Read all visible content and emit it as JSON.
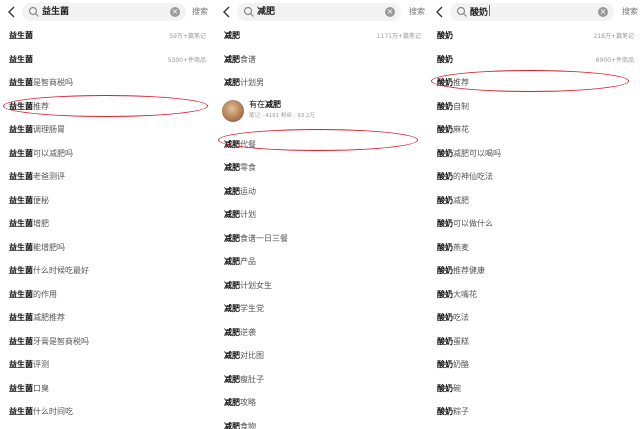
{
  "colors": {
    "highlight_oval": "#d21e2d",
    "search_bg": "#f3f3f3"
  },
  "panels": [
    {
      "query": "益生菌",
      "search_button": "搜索",
      "rows": [
        {
          "bold": "益生菌",
          "rest": "",
          "meta": "59万+篇笔记"
        },
        {
          "bold": "益生菌",
          "rest": "",
          "meta": "5300+件商品"
        },
        {
          "bold": "益生菌",
          "rest": "是智商税吗",
          "meta": ""
        },
        {
          "bold": "益生菌",
          "rest": "推荐",
          "meta": ""
        },
        {
          "bold": "益生菌",
          "rest": "调理肠胃",
          "meta": ""
        },
        {
          "bold": "益生菌",
          "rest": "可以减肥吗",
          "meta": ""
        },
        {
          "bold": "益生菌",
          "rest": "老爸测评",
          "meta": ""
        },
        {
          "bold": "益生菌",
          "rest": "便秘",
          "meta": ""
        },
        {
          "bold": "益生菌",
          "rest": "增肥",
          "meta": ""
        },
        {
          "bold": "益生菌",
          "rest": "能增肥吗",
          "meta": ""
        },
        {
          "bold": "益生菌",
          "rest": "什么时候吃最好",
          "meta": ""
        },
        {
          "bold": "益生菌",
          "rest": "的作用",
          "meta": ""
        },
        {
          "bold": "益生菌",
          "rest": "减肥推荐",
          "meta": ""
        },
        {
          "bold": "益生菌",
          "rest": "牙膏是智商税吗",
          "meta": ""
        },
        {
          "bold": "益生菌",
          "rest": "评测",
          "meta": ""
        },
        {
          "bold": "益生菌",
          "rest": "口臭",
          "meta": ""
        },
        {
          "bold": "益生菌",
          "rest": "什么时间吃",
          "meta": ""
        }
      ]
    },
    {
      "query": "减肥",
      "search_button": "搜索",
      "rows_top": [
        {
          "bold": "减肥",
          "rest": "",
          "meta": "1171万+篇笔记"
        },
        {
          "bold": "减肥",
          "rest": "食谱",
          "meta": ""
        },
        {
          "bold": "减肥",
          "rest": "计划男",
          "meta": ""
        }
      ],
      "user": {
        "name_prefix": "有在",
        "name_bold": "减肥",
        "sub": "笔记 · 4161 粉丝 · 93.2万"
      },
      "rows_bottom": [
        {
          "bold": "减肥",
          "rest": "代餐",
          "meta": ""
        },
        {
          "bold": "减肥",
          "rest": "零食",
          "meta": ""
        },
        {
          "bold": "减肥",
          "rest": "运动",
          "meta": ""
        },
        {
          "bold": "减肥",
          "rest": "计划",
          "meta": ""
        },
        {
          "bold": "减肥",
          "rest": "食谱一日三餐",
          "meta": ""
        },
        {
          "bold": "减肥",
          "rest": "产品",
          "meta": ""
        },
        {
          "bold": "减肥",
          "rest": "计划女生",
          "meta": ""
        },
        {
          "bold": "减肥",
          "rest": "学生党",
          "meta": ""
        },
        {
          "bold": "减肥",
          "rest": "逆袭",
          "meta": ""
        },
        {
          "bold": "减肥",
          "rest": "对比图",
          "meta": ""
        },
        {
          "bold": "减肥",
          "rest": "瘦肚子",
          "meta": ""
        },
        {
          "bold": "减肥",
          "rest": "攻略",
          "meta": ""
        },
        {
          "bold": "减肥",
          "rest": "食物",
          "meta": ""
        }
      ]
    },
    {
      "query": "酸奶",
      "search_button": "搜索",
      "rows": [
        {
          "bold": "酸奶",
          "rest": "",
          "meta": "218万+篇笔记"
        },
        {
          "bold": "酸奶",
          "rest": "",
          "meta": "6900+件商品"
        },
        {
          "bold": "酸奶",
          "rest": "推荐",
          "meta": ""
        },
        {
          "bold": "酸奶",
          "rest": "自制",
          "meta": ""
        },
        {
          "bold": "酸奶",
          "rest": "麻花",
          "meta": ""
        },
        {
          "bold": "酸奶",
          "rest": "减肥可以喝吗",
          "meta": ""
        },
        {
          "bold": "酸奶",
          "rest": "的神仙吃法",
          "meta": ""
        },
        {
          "bold": "酸奶",
          "rest": "减肥",
          "meta": ""
        },
        {
          "bold": "酸奶",
          "rest": "可以做什么",
          "meta": ""
        },
        {
          "bold": "酸奶",
          "rest": "燕麦",
          "meta": ""
        },
        {
          "bold": "酸奶",
          "rest": "推荐健康",
          "meta": ""
        },
        {
          "bold": "酸奶",
          "rest": "大嘴花",
          "meta": ""
        },
        {
          "bold": "酸奶",
          "rest": "吃法",
          "meta": ""
        },
        {
          "bold": "酸奶",
          "rest": "蛋糕",
          "meta": ""
        },
        {
          "bold": "酸奶",
          "rest": "奶酪",
          "meta": ""
        },
        {
          "bold": "酸奶",
          "rest": "碗",
          "meta": ""
        },
        {
          "bold": "酸奶",
          "rest": "粽子",
          "meta": ""
        }
      ]
    }
  ]
}
